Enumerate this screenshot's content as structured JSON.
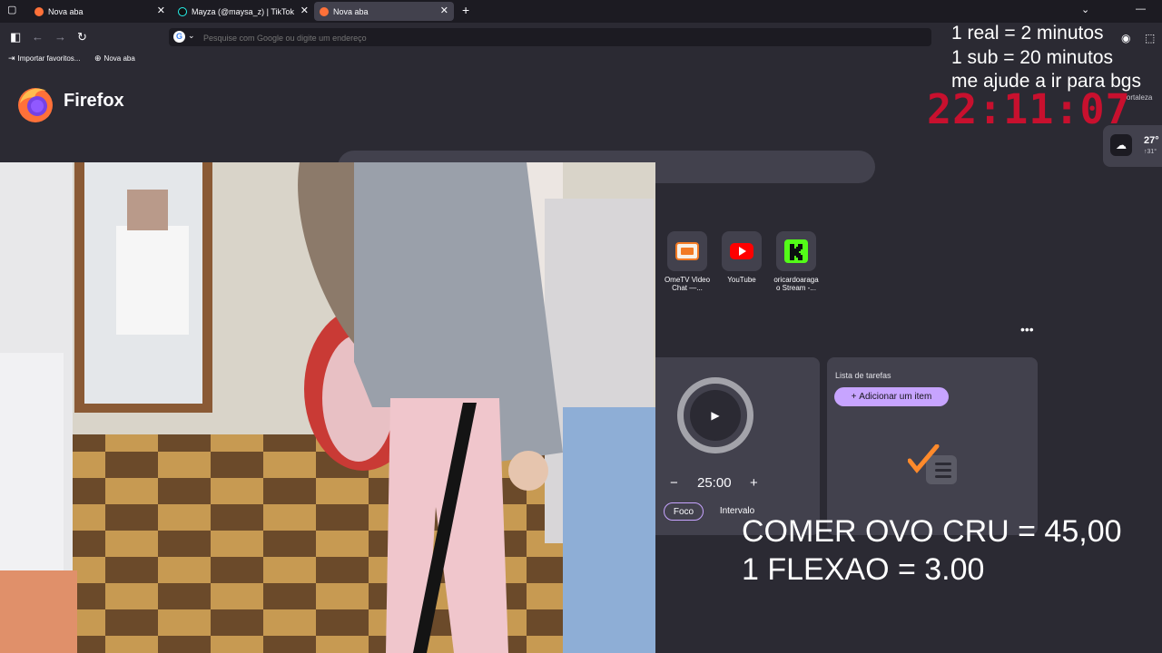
{
  "tabs": [
    {
      "title": "Nova aba",
      "active": false,
      "favicon": "firefox-icon"
    },
    {
      "title": "Mayza (@maysa_z) | TikTok",
      "active": false,
      "favicon": "tiktok-icon"
    },
    {
      "title": "Nova aba",
      "active": true,
      "favicon": "firefox-icon"
    }
  ],
  "url_bar": {
    "placeholder": "Pesquise com Google ou digite um endereço"
  },
  "bookmarks": [
    {
      "label": "Importar favoritos...",
      "icon": "import-icon"
    },
    {
      "label": "Nova aba",
      "icon": "globe-icon"
    }
  ],
  "brand": {
    "name": "Firefox"
  },
  "shortcuts": [
    {
      "label": "OmeTV Video Chat —...",
      "icon": "ometv-icon"
    },
    {
      "label": "YouTube",
      "icon": "youtube-icon"
    },
    {
      "label": "oricardoaraga o Stream -...",
      "icon": "kick-icon"
    }
  ],
  "timer": {
    "time": "25:00",
    "minus": "−",
    "plus": "+",
    "focus_label": "Foco",
    "break_label": "Intervalo"
  },
  "tasks": {
    "title": "Lista de tarefas",
    "add_label": "Adicionar um item"
  },
  "weather": {
    "city": "Fortaleza",
    "temp": "27°",
    "detail": "↑31°"
  },
  "overlay": {
    "lines_top": [
      "1 real = 2 minutos",
      "1 sub = 20 minutos",
      "me ajude a ir para bgs"
    ],
    "clock": "22:11:07",
    "lines_bottom": [
      "COMER OVO CRU = 45,00",
      "1 FLEXAO = 3.00"
    ]
  },
  "colors": {
    "bg": "#2b2a33",
    "tabbar": "#1c1b22",
    "card": "#42414d",
    "accent": "#c7a4ff",
    "clock": "#c8102e"
  }
}
